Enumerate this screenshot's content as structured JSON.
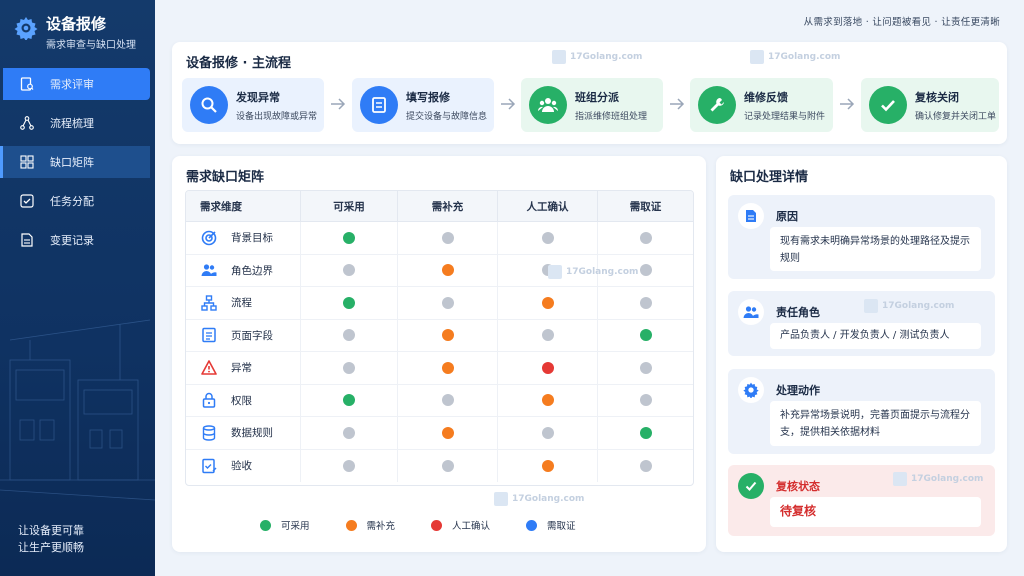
{
  "app": {
    "title": "设备报修",
    "subtitle": "需求审查与缺口处理"
  },
  "nav": [
    {
      "label": "需求评审",
      "icon": "review-icon"
    },
    {
      "label": "流程梳理",
      "icon": "flow-icon"
    },
    {
      "label": "缺口矩阵",
      "icon": "matrix-icon"
    },
    {
      "label": "任务分配",
      "icon": "task-icon"
    },
    {
      "label": "变更记录",
      "icon": "record-icon"
    }
  ],
  "slogan": [
    "让设备更可靠",
    "让生产更顺畅"
  ],
  "top_text": "从需求到落地 · 让问题被看见 · 让责任更清晰",
  "flow": {
    "title": "设备报修 · 主流程",
    "steps": [
      {
        "title": "发现异常",
        "desc": "设备出现故障或异常",
        "icon": "search-icon",
        "color": "#2f7cf6",
        "bg": "#eaf2fe"
      },
      {
        "title": "填写报修",
        "desc": "提交设备与故障信息",
        "icon": "form-icon",
        "color": "#2f7cf6",
        "bg": "#eaf2fe"
      },
      {
        "title": "班组分派",
        "desc": "指派维修班组处理",
        "icon": "team-icon",
        "color": "#27b067",
        "bg": "#e8f7ef"
      },
      {
        "title": "维修反馈",
        "desc": "记录处理结果与附件",
        "icon": "wrench-icon",
        "color": "#27b067",
        "bg": "#e8f7ef"
      },
      {
        "title": "复核关闭",
        "desc": "确认修复并关闭工单",
        "icon": "check-icon",
        "color": "#27b067",
        "bg": "#e8f7ef"
      }
    ]
  },
  "matrix": {
    "title": "需求缺口矩阵",
    "headers": [
      "需求维度",
      "可采用",
      "需补充",
      "人工确认",
      "需取证"
    ],
    "rows": [
      {
        "label": "背景目标",
        "icon": "target-icon",
        "status": [
          "green",
          "gray",
          "gray",
          "gray"
        ]
      },
      {
        "label": "角色边界",
        "icon": "users-icon",
        "status": [
          "gray",
          "orange",
          "gray",
          "gray"
        ]
      },
      {
        "label": "流程",
        "icon": "hierarchy-icon",
        "status": [
          "green",
          "gray",
          "orange",
          "gray"
        ]
      },
      {
        "label": "页面字段",
        "icon": "form-icon",
        "status": [
          "gray",
          "orange",
          "gray",
          "green"
        ]
      },
      {
        "label": "异常",
        "icon": "warning-icon",
        "status": [
          "gray",
          "orange",
          "red",
          "gray"
        ]
      },
      {
        "label": "权限",
        "icon": "lock-icon",
        "status": [
          "green",
          "gray",
          "orange",
          "gray"
        ]
      },
      {
        "label": "数据规则",
        "icon": "database-icon",
        "status": [
          "gray",
          "orange",
          "gray",
          "green"
        ]
      },
      {
        "label": "验收",
        "icon": "checklist-icon",
        "status": [
          "gray",
          "gray",
          "orange",
          "gray"
        ]
      }
    ],
    "legend": [
      {
        "label": "可采用",
        "color": "#27b067"
      },
      {
        "label": "需补充",
        "color": "#f57c1f"
      },
      {
        "label": "人工确认",
        "color": "#e53935"
      },
      {
        "label": "需取证",
        "color": "#2f7cf6"
      }
    ]
  },
  "colors": {
    "green": "#27b067",
    "orange": "#f57c1f",
    "red": "#e53935",
    "blue": "#2f7cf6",
    "gray": "#bfc5cf"
  },
  "detail": {
    "title": "缺口处理详情",
    "cause": {
      "title": "原因",
      "body": "现有需求未明确异常场景的处理路径及提示规则"
    },
    "role": {
      "title": "责任角色",
      "body": "产品负责人 / 开发负责人 / 测试负责人"
    },
    "action": {
      "title": "处理动作",
      "body": "补充异常场景说明，完善页面提示与流程分支，提供相关依据材料"
    },
    "status": {
      "title": "复核状态",
      "value": "待复核"
    }
  },
  "watermark": "17Golang.com"
}
